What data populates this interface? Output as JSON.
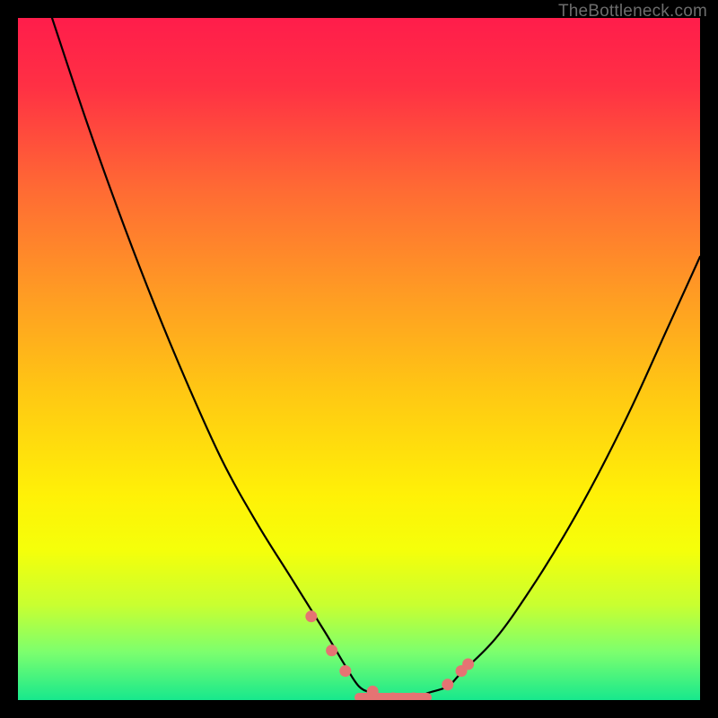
{
  "watermark": "TheBottleneck.com",
  "gradient": {
    "stops": [
      {
        "offset": 0.0,
        "color": "#ff1d4b"
      },
      {
        "offset": 0.1,
        "color": "#ff3044"
      },
      {
        "offset": 0.25,
        "color": "#ff6a34"
      },
      {
        "offset": 0.4,
        "color": "#ff9a24"
      },
      {
        "offset": 0.55,
        "color": "#ffc813"
      },
      {
        "offset": 0.7,
        "color": "#fff107"
      },
      {
        "offset": 0.78,
        "color": "#f5ff0a"
      },
      {
        "offset": 0.86,
        "color": "#c9ff30"
      },
      {
        "offset": 0.93,
        "color": "#7cff6e"
      },
      {
        "offset": 1.0,
        "color": "#17e88d"
      }
    ]
  },
  "chart_data": {
    "type": "line",
    "title": "",
    "xlabel": "",
    "ylabel": "",
    "xlim": [
      0,
      100
    ],
    "ylim": [
      0,
      100
    ],
    "series": [
      {
        "name": "bottleneck-curve",
        "x": [
          5,
          10,
          15,
          20,
          25,
          30,
          35,
          40,
          45,
          48,
          50,
          52,
          55,
          58,
          60,
          63,
          65,
          70,
          75,
          80,
          85,
          90,
          95,
          100
        ],
        "values": [
          100,
          85,
          71,
          58,
          46,
          35,
          26,
          18,
          10,
          5,
          2,
          1,
          0,
          0,
          1,
          2,
          4,
          9,
          16,
          24,
          33,
          43,
          54,
          65
        ]
      }
    ],
    "markers": {
      "name": "highlight-points",
      "x": [
        43,
        46,
        48,
        52,
        55,
        58,
        63,
        65,
        66
      ],
      "values": [
        12,
        7,
        4,
        1,
        0,
        0,
        2,
        4,
        5
      ]
    },
    "flat_segment": {
      "x0": 50,
      "x1": 60,
      "y": 0
    }
  }
}
